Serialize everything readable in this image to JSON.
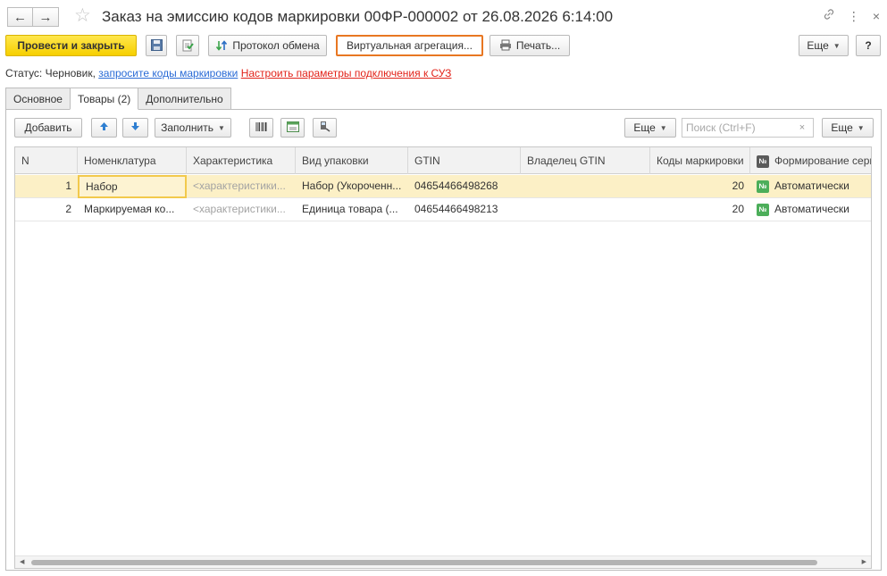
{
  "window": {
    "title": "Заказ на эмиссию кодов маркировки 00ФР-000002 от 26.08.2026 6:14:00",
    "back_icon": "←",
    "forward_icon": "→",
    "star_icon": "☆",
    "link_icon": "🔗",
    "more_icon": "⋮",
    "close_icon": "×"
  },
  "toolbar": {
    "post_close_label": "Провести и закрыть",
    "exchange_log_label": "Протокол обмена",
    "virtual_aggregation_label": "Виртуальная агрегация...",
    "print_label": "Печать...",
    "more_label": "Еще",
    "help_label": "?"
  },
  "status": {
    "prefix": "Статус: Черновик,",
    "request_link": "запросите коды маркировки",
    "settings_link": "Настроить параметры подключения к СУЗ"
  },
  "tabs": [
    {
      "label": "Основное"
    },
    {
      "label": "Товары (2)"
    },
    {
      "label": "Дополнительно"
    }
  ],
  "goods_toolbar": {
    "add_label": "Добавить",
    "fill_label": "Заполнить",
    "more_label": "Еще",
    "more_label_2": "Еще",
    "search_placeholder": "Поиск (Ctrl+F)",
    "clear_icon": "×"
  },
  "table": {
    "columns": [
      "N",
      "Номенклатура",
      "Характеристика",
      "Вид упаковки",
      "GTIN",
      "Владелец GTIN",
      "Коды маркировки",
      "Формирование сери"
    ],
    "rows": [
      {
        "n": "1",
        "item": "Набор",
        "characteristic": "<характеристики...",
        "package": "Набор (Укороченн...",
        "gtin": "04654466498268",
        "owner": "",
        "codes": "20",
        "series": "Автоматически"
      },
      {
        "n": "2",
        "item": "Маркируемая ко...",
        "characteristic": "<характеристики...",
        "package": "Единица товара (...",
        "gtin": "04654466498213",
        "owner": "",
        "codes": "20",
        "series": "Автоматически"
      }
    ],
    "badge_text": "№"
  },
  "colors": {
    "primary_button": "#f6cf00",
    "focus_outline": "#e87722",
    "link_blue": "#2a6bd6",
    "link_red": "#e2231a",
    "selected_row": "#fcf0c6"
  }
}
